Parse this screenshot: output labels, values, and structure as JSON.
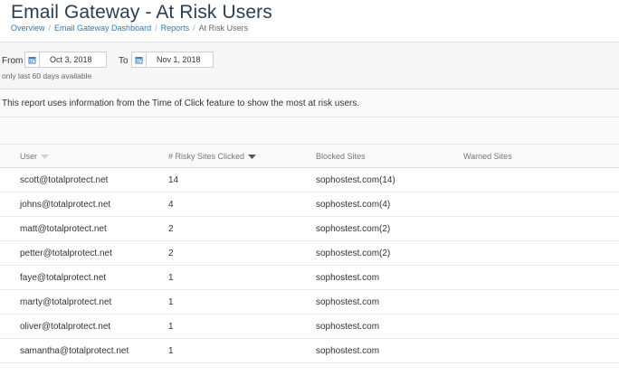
{
  "header": {
    "title": "Email Gateway - At Risk Users",
    "breadcrumb": [
      "Overview",
      "Email Gateway Dashboard",
      "Reports",
      "At Risk Users"
    ]
  },
  "filters": {
    "from_label": "From",
    "from_date": "Oct 3, 2018",
    "to_label": "To",
    "to_date": "Nov 1, 2018",
    "note": "only last 60 days available"
  },
  "description": "This report uses information from the Time of Click feature to show the most at risk users.",
  "table": {
    "columns": [
      "User",
      "# Risky Sites Clicked",
      "Blocked Sites",
      "Warned Sites"
    ],
    "rows": [
      {
        "user": "scott@totalprotect.net",
        "clicked": "14",
        "blocked": "sophostest.com(14)",
        "warned": ""
      },
      {
        "user": "johns@totalprotect.net",
        "clicked": "4",
        "blocked": "sophostest.com(4)",
        "warned": ""
      },
      {
        "user": "matt@totalprotect.net",
        "clicked": "2",
        "blocked": "sophostest.com(2)",
        "warned": ""
      },
      {
        "user": "petter@totalprotect.net",
        "clicked": "2",
        "blocked": "sophostest.com(2)",
        "warned": ""
      },
      {
        "user": "faye@totalprotect.net",
        "clicked": "1",
        "blocked": "sophostest.com",
        "warned": ""
      },
      {
        "user": "marty@totalprotect.net",
        "clicked": "1",
        "blocked": "sophostest.com",
        "warned": ""
      },
      {
        "user": "oliver@totalprotect.net",
        "clicked": "1",
        "blocked": "sophostest.com",
        "warned": ""
      },
      {
        "user": "samantha@totalprotect.net",
        "clicked": "1",
        "blocked": "sophostest.com",
        "warned": ""
      }
    ]
  },
  "colors": {
    "title": "#2c3e50",
    "link": "#2a7ab8",
    "calendar_icon": "#3a7dc2"
  },
  "icons": {
    "calendar": "calendar-icon",
    "sort_inactive": "sort-down-icon",
    "sort_active": "sort-down-active-icon"
  }
}
